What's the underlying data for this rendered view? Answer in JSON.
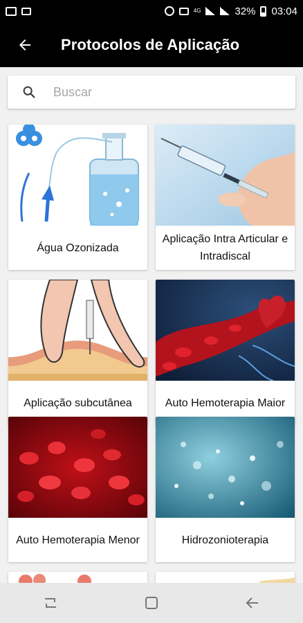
{
  "status_bar": {
    "battery": "32%",
    "time": "03:04",
    "network_label": "4G"
  },
  "app_bar": {
    "title": "Protocolos de Aplicação"
  },
  "search": {
    "placeholder": "Buscar"
  },
  "cards": [
    {
      "label": "Água Ozonizada"
    },
    {
      "label": "Aplicação Intra Articular e Intradiscal"
    },
    {
      "label": "Aplicação subcutânea"
    },
    {
      "label": "Auto Hemoterapia Maior"
    },
    {
      "label": "Auto Hemoterapia Menor"
    },
    {
      "label": "Hidrozonioterapia"
    }
  ],
  "colors": {
    "app_bar": "#000000",
    "background": "#f1f1f1",
    "card": "#ffffff"
  },
  "icons": {
    "back": "arrow-left-icon",
    "search": "search-icon",
    "nav_recent": "recent-apps-icon",
    "nav_home": "home-icon",
    "nav_back": "nav-back-icon"
  }
}
